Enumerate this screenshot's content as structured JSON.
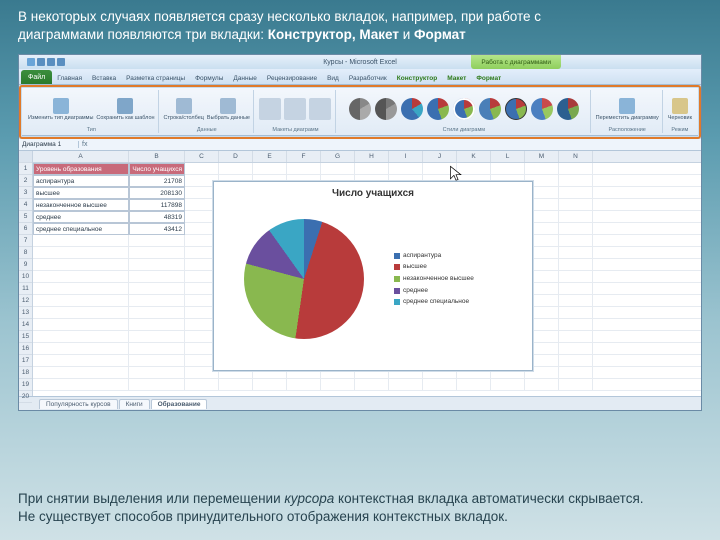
{
  "slide": {
    "top_line1": "В некоторых случаях появляется сразу несколько вкладок, например, при работе с",
    "top_line2a": "диаграммами появляются три вкладки: ",
    "top_line2b": "Конструктор, Макет",
    "top_line2c": " и ",
    "top_line2d": "Формат",
    "bottom_line1a": "При снятии выделения или перемещении ",
    "bottom_line1b": "курсора",
    "bottom_line1c": " контекстная вкладка автоматически скрывается.",
    "bottom_line2": "Не существует способов принудительного отображения контекстных вкладок."
  },
  "excel": {
    "app_title": "Курсы - Microsoft Excel",
    "context_title": "Работа с диаграммами",
    "file_tab": "Файл",
    "menu_tabs": [
      "Главная",
      "Вставка",
      "Разметка страницы",
      "Формулы",
      "Данные",
      "Рецензирование",
      "Вид",
      "Разработчик"
    ],
    "ctx_tabs": [
      "Конструктор",
      "Макет",
      "Формат"
    ],
    "ribbon": {
      "g1_btn1": "Изменить тип диаграммы",
      "g1_btn2": "Сохранить как шаблон",
      "g1_label": "Тип",
      "g2_btn1": "Строка/столбец",
      "g2_btn2": "Выбрать данные",
      "g2_label": "Данные",
      "g3_label": "Макеты диаграмм",
      "g4_label": "Стили диаграмм",
      "g5_btn1": "Переместить диаграмму",
      "g5_label": "Расположение",
      "g6_btn1": "Черновик",
      "g6_label": "Режим"
    },
    "namebox": "Диаграмма 1",
    "fx": "fx",
    "columns": [
      "A",
      "B",
      "C",
      "D",
      "E",
      "F",
      "G",
      "H",
      "I",
      "J",
      "K",
      "L",
      "M",
      "N"
    ],
    "rows": [
      "1",
      "2",
      "3",
      "4",
      "5",
      "6",
      "7",
      "8",
      "9",
      "10",
      "11",
      "12",
      "13",
      "14",
      "15",
      "16",
      "17",
      "18",
      "19",
      "20"
    ],
    "table": {
      "h1": "Уровень образования",
      "h2": "Число учащихся",
      "r": [
        {
          "a": "аспирантура",
          "b": "21708"
        },
        {
          "a": "высшее",
          "b": "208130"
        },
        {
          "a": "незаконченное высшее",
          "b": "117898"
        },
        {
          "a": "среднее",
          "b": "48319"
        },
        {
          "a": "среднее специальное",
          "b": "43412"
        }
      ]
    },
    "chart": {
      "title": "Число учащихся",
      "legend": [
        "аспирантура",
        "высшее",
        "незаконченное высшее",
        "среднее",
        "среднее специальное"
      ]
    },
    "sheet_tabs": [
      "Популярность курсов",
      "Книги",
      "Образование"
    ]
  },
  "chart_data": {
    "type": "pie",
    "title": "Число учащихся",
    "categories": [
      "аспирантура",
      "высшее",
      "незаконченное высшее",
      "среднее",
      "среднее специальное"
    ],
    "values": [
      21708,
      208130,
      117898,
      48319,
      43412
    ],
    "colors": [
      "#3b6fb0",
      "#b83b3b",
      "#89b84f",
      "#6a4f9e",
      "#3aa6c4"
    ]
  }
}
